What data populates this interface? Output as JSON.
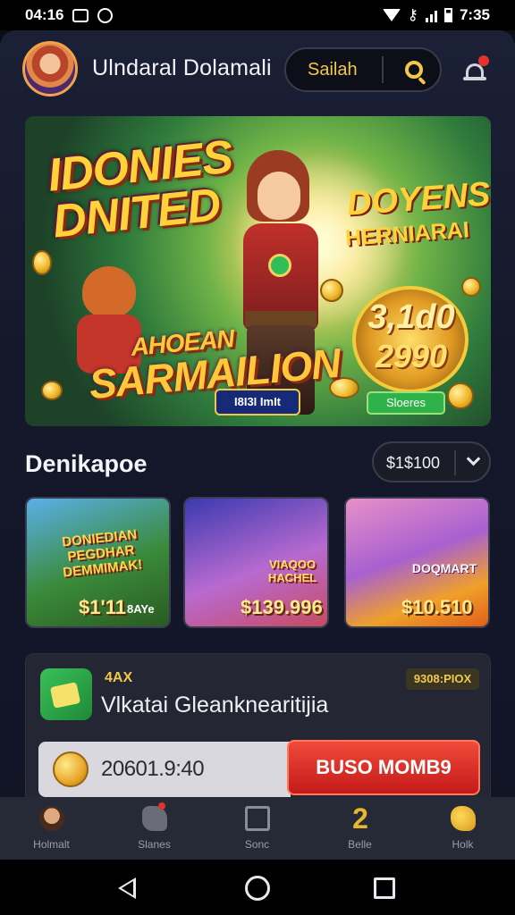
{
  "status_bar": {
    "time_left": "04:16",
    "time_right": "7:35"
  },
  "header": {
    "title": "Ulndaral Dolamali",
    "search_label": "Sailah"
  },
  "banner": {
    "title_line1": "IDONIES",
    "title_line2": "DNITED",
    "subtitle_line1": "AHOEAN",
    "subtitle_line2": "SARMAILION",
    "right_title": "DOYENS",
    "right_subtitle": "HERNIARAI",
    "jackpot_line1": "3,1d0",
    "jackpot_line2": "2990",
    "button_primary": "I8I3I ImIt",
    "button_secondary": "Sloeres"
  },
  "section": {
    "title": "Denikapoe",
    "sort_value": "$1$100"
  },
  "cards": [
    {
      "label": "DONIEDIAN PEGDHAR DEMMIMAK!",
      "price": "$1'11",
      "tag": "8AYe"
    },
    {
      "label": "VIAQOO HACHEL",
      "price": "$139.996"
    },
    {
      "label": "DOQMART",
      "price": "$10.510"
    }
  ],
  "promo": {
    "kicker": "4AX",
    "badge": "9308:PIOX",
    "headline": "Vlkatai Gleanknearitijia",
    "amount": "20601.9:40",
    "cta_label": "BUSO MOMB9"
  },
  "nav": {
    "items": [
      {
        "label": "Holmalt"
      },
      {
        "label": "Slanes"
      },
      {
        "label": "Sonc"
      },
      {
        "label": "Belle",
        "icon_text": "2"
      },
      {
        "label": "Holk"
      }
    ]
  },
  "colors": {
    "accent": "#f3c84a",
    "cta": "#d82a22",
    "panel": "#242634",
    "background": "#14182a"
  }
}
